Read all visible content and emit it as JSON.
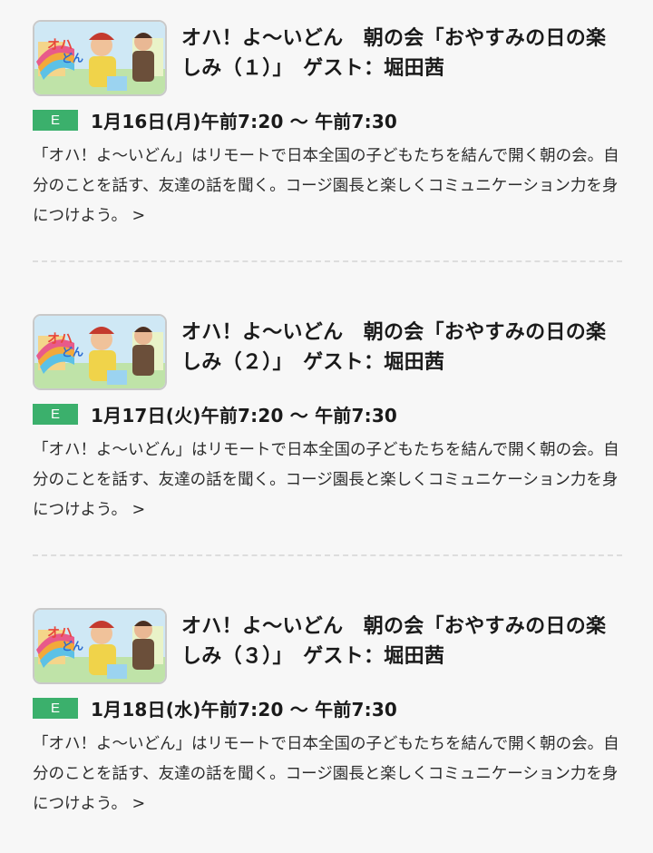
{
  "programs": [
    {
      "title": "オハ！よ〜いどん　朝の会「おやすみの日の楽しみ（１）」　ゲスト：堀田茜",
      "channel": "E",
      "airtime": "1月16日(月)午前7:20 ～ 午前7:30",
      "description": "「オハ！よ〜いどん」はリモートで日本全国の子どもたちを結んで開く朝の会。自分のことを話す、友達の話を聞く。コージ園長と楽しくコミュニケーション力を身につけよう。",
      "more_icon": ">"
    },
    {
      "title": "オハ！よ〜いどん　朝の会「おやすみの日の楽しみ（２）」　ゲスト：堀田茜",
      "channel": "E",
      "airtime": "1月17日(火)午前7:20 ～ 午前7:30",
      "description": "「オハ！よ〜いどん」はリモートで日本全国の子どもたちを結んで開く朝の会。自分のことを話す、友達の話を聞く。コージ園長と楽しくコミュニケーション力を身につけよう。",
      "more_icon": ">"
    },
    {
      "title": "オハ！よ〜いどん　朝の会「おやすみの日の楽しみ（３）」　ゲスト：堀田茜",
      "channel": "E",
      "airtime": "1月18日(水)午前7:20 ～ 午前7:30",
      "description": "「オハ！よ〜いどん」はリモートで日本全国の子どもたちを結んで開く朝の会。自分のことを話す、友達の話を聞く。コージ園長と楽しくコミュニケーション力を身につけよう。",
      "more_icon": ">"
    }
  ],
  "colors": {
    "channel_badge": "#3bb06c",
    "background": "#f7f7f7",
    "divider": "#dddddd"
  },
  "icons": {
    "thumbnail": "program-thumbnail-image",
    "more": "chevron-right-icon"
  }
}
